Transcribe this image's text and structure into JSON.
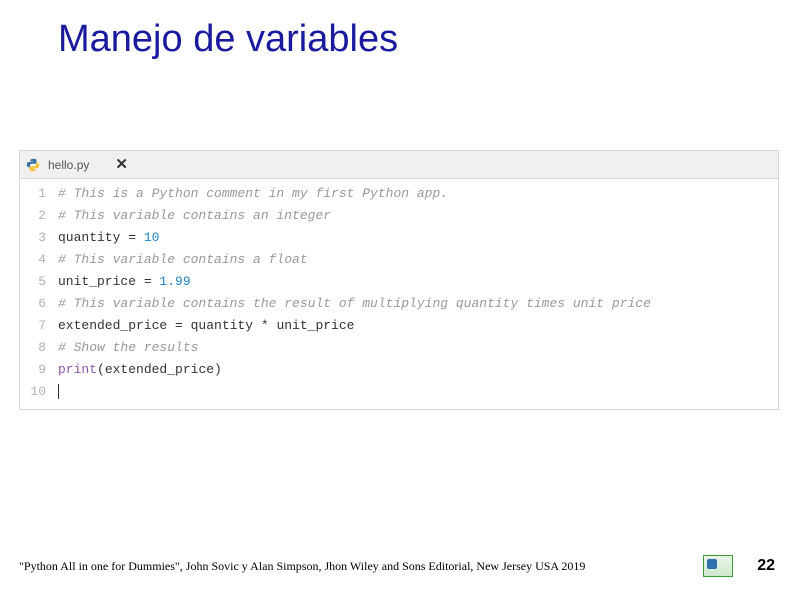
{
  "title": "Manejo de variables",
  "editor": {
    "tab_filename": "hello.py",
    "tab_close_glyph": "✕",
    "lines": [
      {
        "n": "1",
        "tokens": [
          {
            "cls": "tok-comment",
            "t": "# This is a Python comment in my first Python app."
          }
        ]
      },
      {
        "n": "2",
        "tokens": [
          {
            "cls": "tok-comment",
            "t": "# This variable contains an integer"
          }
        ]
      },
      {
        "n": "3",
        "tokens": [
          {
            "cls": "tok-var",
            "t": "quantity"
          },
          {
            "cls": "tok-op",
            "t": " = "
          },
          {
            "cls": "tok-num",
            "t": "10"
          }
        ]
      },
      {
        "n": "4",
        "tokens": [
          {
            "cls": "tok-comment",
            "t": "# This variable contains a float"
          }
        ]
      },
      {
        "n": "5",
        "tokens": [
          {
            "cls": "tok-var",
            "t": "unit_price"
          },
          {
            "cls": "tok-op",
            "t": " = "
          },
          {
            "cls": "tok-num",
            "t": "1.99"
          }
        ]
      },
      {
        "n": "6",
        "tokens": [
          {
            "cls": "tok-comment",
            "t": "# This variable contains the result of multiplying quantity times unit price"
          }
        ]
      },
      {
        "n": "7",
        "tokens": [
          {
            "cls": "tok-var",
            "t": "extended_price"
          },
          {
            "cls": "tok-op",
            "t": " = "
          },
          {
            "cls": "tok-var",
            "t": "quantity"
          },
          {
            "cls": "tok-op",
            "t": " * "
          },
          {
            "cls": "tok-var",
            "t": "unit_price"
          }
        ]
      },
      {
        "n": "8",
        "tokens": [
          {
            "cls": "tok-comment",
            "t": "# Show the results"
          }
        ]
      },
      {
        "n": "9",
        "tokens": [
          {
            "cls": "tok-builtin",
            "t": "print"
          },
          {
            "cls": "tok-paren",
            "t": "("
          },
          {
            "cls": "tok-var",
            "t": "extended_price"
          },
          {
            "cls": "tok-paren",
            "t": ")"
          }
        ]
      },
      {
        "n": "10",
        "tokens": []
      }
    ]
  },
  "footer": {
    "citation": "\"Python All in one for Dummies\", John Sovic y Alan Simpson, Jhon Wiley and Sons Editorial, New Jersey USA 2019",
    "page_number": "22"
  }
}
